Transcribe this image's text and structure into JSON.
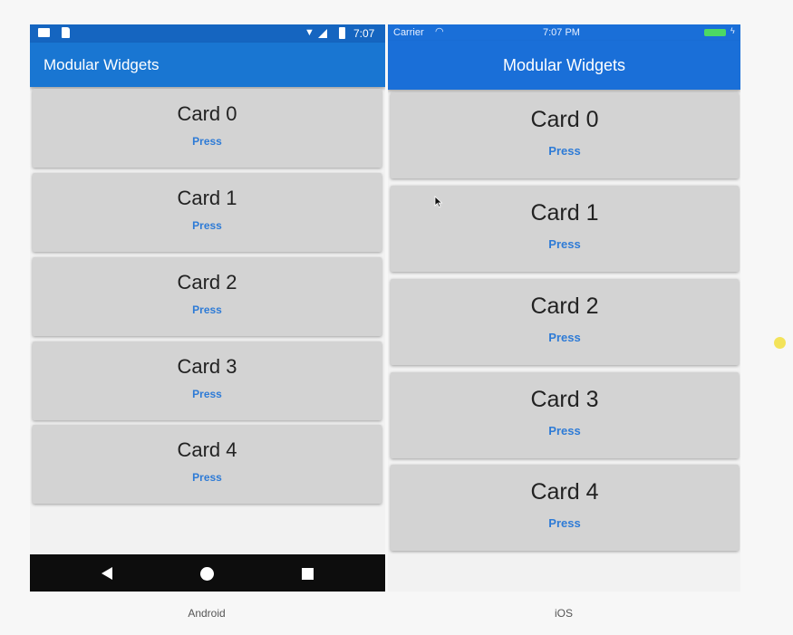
{
  "android": {
    "status_time": "7:07",
    "title": "Modular Widgets",
    "cards": [
      {
        "title": "Card 0",
        "button": "Press"
      },
      {
        "title": "Card 1",
        "button": "Press"
      },
      {
        "title": "Card 2",
        "button": "Press"
      },
      {
        "title": "Card 3",
        "button": "Press"
      },
      {
        "title": "Card 4",
        "button": "Press"
      }
    ],
    "platform_label": "Android"
  },
  "ios": {
    "carrier": "Carrier",
    "status_time": "7:07 PM",
    "title": "Modular Widgets",
    "cards": [
      {
        "title": "Card 0",
        "button": "Press"
      },
      {
        "title": "Card 1",
        "button": "Press"
      },
      {
        "title": "Card 2",
        "button": "Press"
      },
      {
        "title": "Card 3",
        "button": "Press"
      },
      {
        "title": "Card 4",
        "button": "Press"
      }
    ],
    "platform_label": "iOS"
  },
  "colors": {
    "android_appbar": "#1976d2",
    "ios_navbar": "#1a6fd8",
    "card": "#d3d3d3",
    "button_text": "#2e7bd6",
    "battery": "#4cd964"
  }
}
